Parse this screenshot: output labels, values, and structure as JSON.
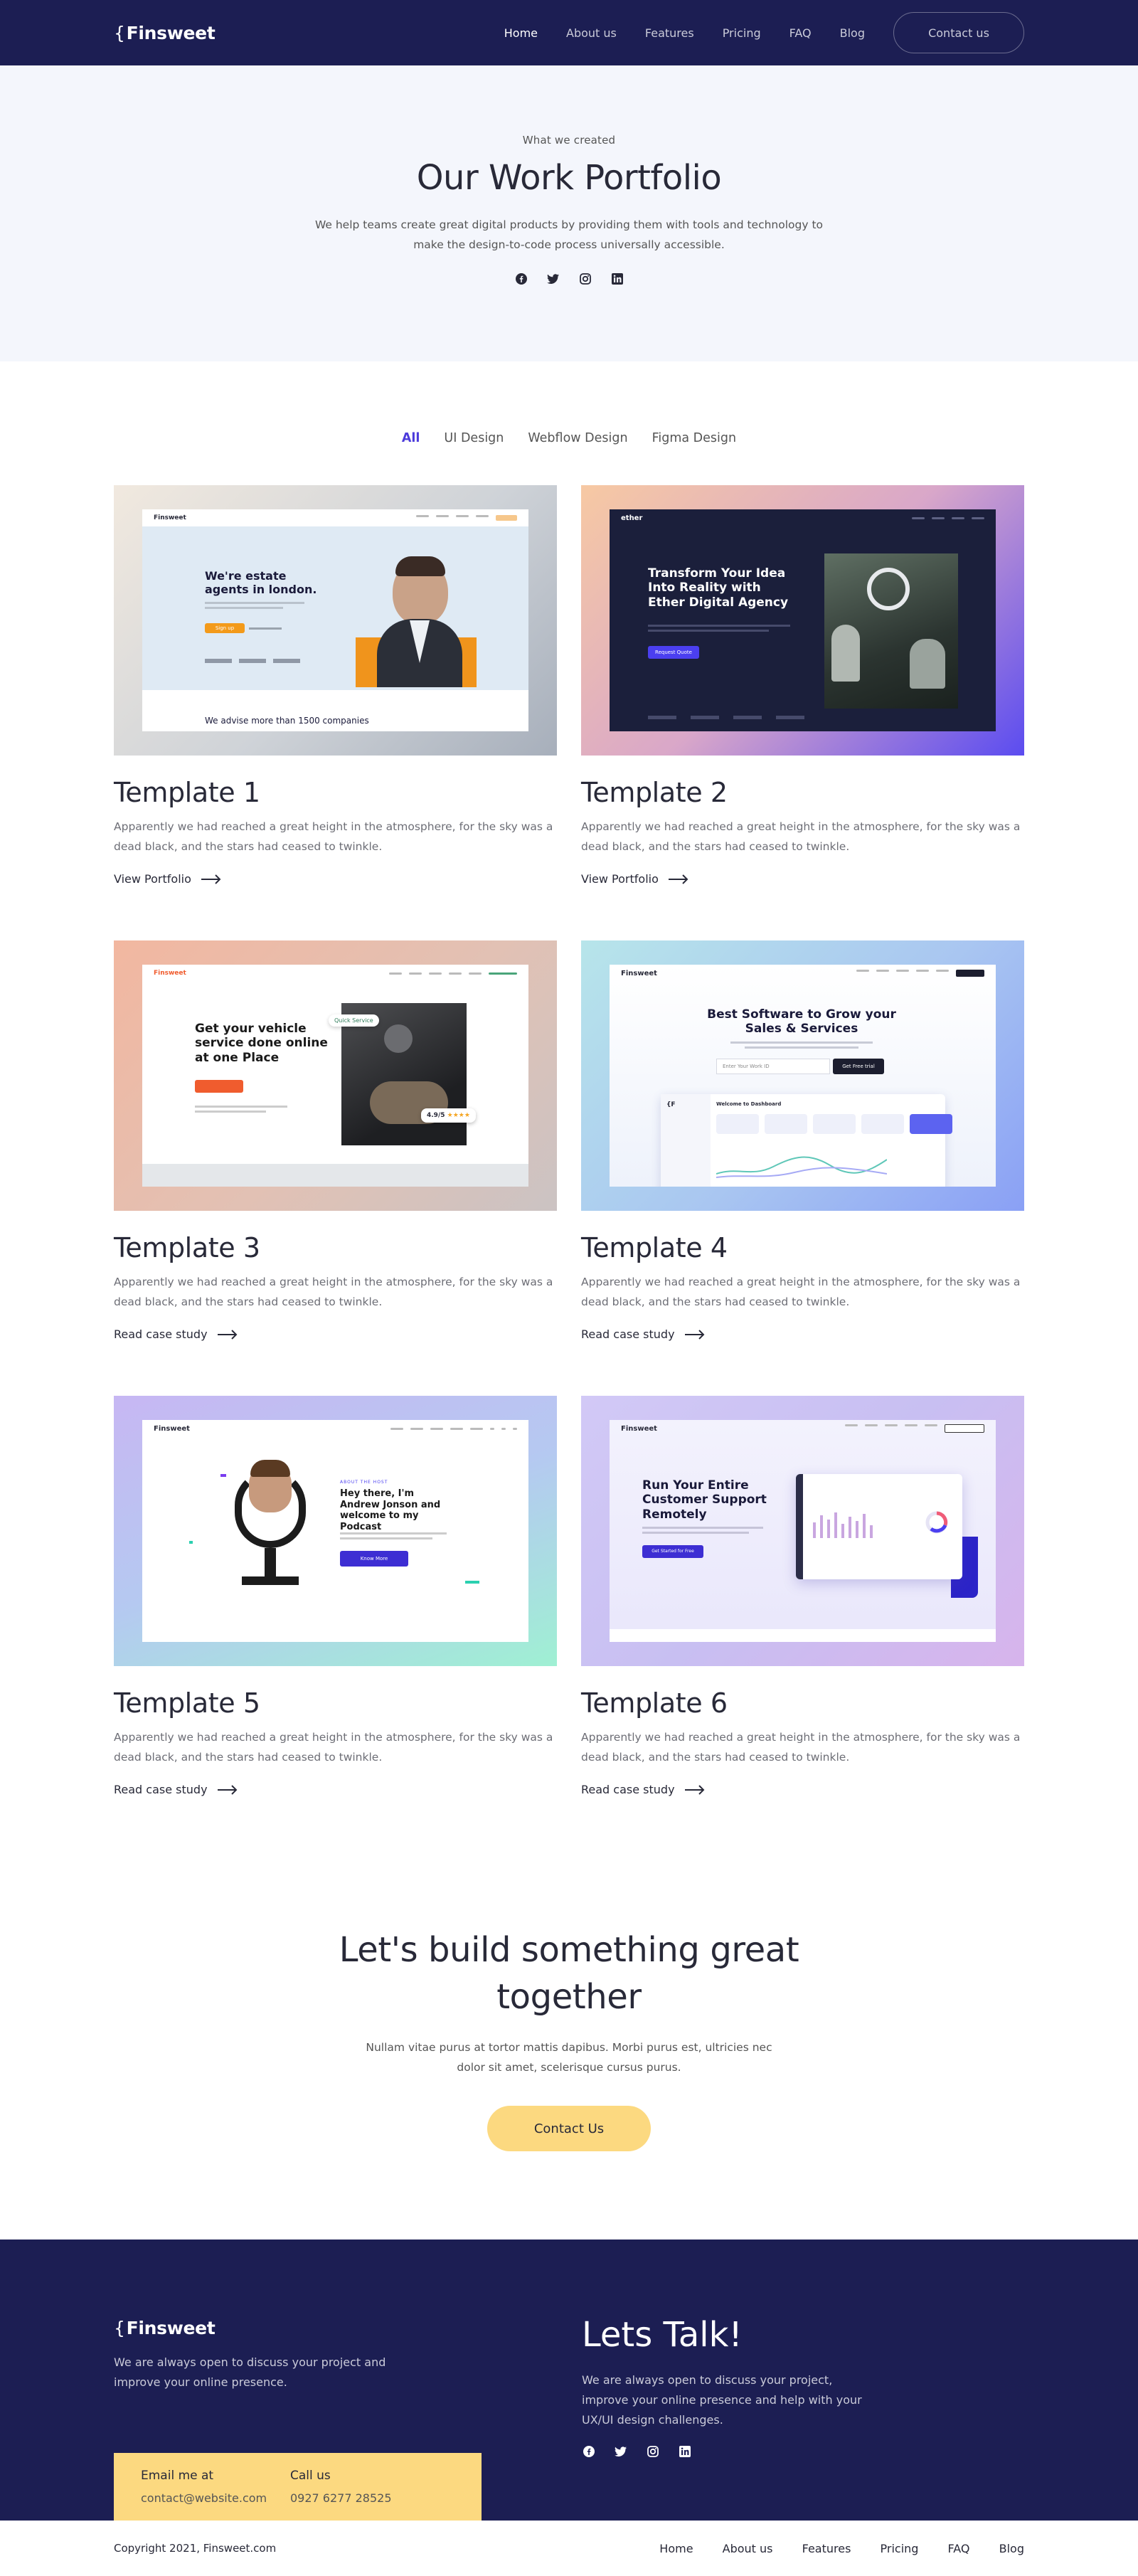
{
  "header": {
    "logo": "Finsweet",
    "nav": [
      "Home",
      "About us",
      "Features",
      "Pricing",
      "FAQ",
      "Blog"
    ],
    "cta": "Contact us"
  },
  "hero": {
    "eyebrow": "What we created",
    "title": "Our Work Portfolio",
    "description": "We help teams create great digital products by providing them with tools and technology to make the design-to-code process universally accessible.",
    "socials": [
      "facebook-icon",
      "twitter-icon",
      "instagram-icon",
      "linkedin-icon"
    ]
  },
  "filters": [
    "All",
    "UI Design",
    "Webflow Design",
    "Figma Design"
  ],
  "cards": [
    {
      "title": "Template 1",
      "desc": "Apparently we had reached a great height in the atmosphere, for the sky was a dead black, and the stars had ceased to twinkle.",
      "link": "View Portfolio",
      "mock": {
        "brand": "Finsweet",
        "headline": "We're estate agents in london.",
        "button": "Sign up",
        "bottom": "We advise more than 1500 companies"
      }
    },
    {
      "title": "Template 2",
      "desc": "Apparently we had reached a great height in the atmosphere, for the sky was a dead black, and the stars had ceased to twinkle.",
      "link": "View Portfolio",
      "mock": {
        "brand": "ether",
        "headline": "Transform Your Idea Into Reality with Ether Digital Agency",
        "button": "Request Quote"
      }
    },
    {
      "title": "Template 3",
      "desc": "Apparently we had reached a great height in the atmosphere, for the sky was a dead black, and the stars had ceased to twinkle.",
      "link": "Read case study",
      "mock": {
        "brand": "Finsweet",
        "headline": "Get your vehicle service done online at one Place",
        "badge": "Quick Service",
        "rating": "4.9/5"
      }
    },
    {
      "title": "Template 4",
      "desc": "Apparently we had reached a great height in the atmosphere, for the sky was a dead black, and the stars had ceased to twinkle.",
      "link": "Read case study",
      "mock": {
        "brand": "Finsweet",
        "headline": "Best Software to Grow your Sales & Services",
        "button": "Get Free trial",
        "input": "Enter Your Work ID",
        "dashboard": "Welcome to Dashboard"
      }
    },
    {
      "title": "Template 5",
      "desc": "Apparently we had reached a great height in the atmosphere, for the sky was a dead black, and the stars had ceased to twinkle.",
      "link": "Read case study",
      "mock": {
        "brand": "Finsweet",
        "eyebrow": "ABOUT THE HOST",
        "headline": "Hey there, I'm Andrew Jonson and welcome to my Podcast",
        "button": "Know More"
      }
    },
    {
      "title": "Template 6",
      "desc": "Apparently we had reached a great height in the atmosphere, for the sky was a dead black, and the stars had ceased to twinkle.",
      "link": "Read case study",
      "mock": {
        "brand": "Finsweet",
        "headline": "Run Your Entire Customer Support Remotely",
        "button": "Get Started for Free"
      }
    }
  ],
  "cta": {
    "title": "Let's build something great together",
    "description": "Nullam vitae purus at tortor mattis dapibus. Morbi purus est, ultricies nec dolor sit amet, scelerisque cursus purus.",
    "button": "Contact Us"
  },
  "footer": {
    "logo": "Finsweet",
    "tagline": "We are always open to discuss your project and improve your online presence.",
    "talk_title": "Lets Talk!",
    "talk_text": "We are always open to discuss your project, improve your online presence and help with your UX/UI design challenges.",
    "email_label": "Email me at",
    "email": "contact@website.com",
    "call_label": "Call us",
    "phone": "0927 6277 28525",
    "copyright": "Copyright 2021, Finsweet.com",
    "nav": [
      "Home",
      "About us",
      "Features",
      "Pricing",
      "FAQ",
      "Blog"
    ]
  },
  "colors": {
    "navy": "#1c1e53",
    "accent": "#4c3bdb",
    "yellow": "#fcd980",
    "hero_bg": "#f4f6fc"
  }
}
